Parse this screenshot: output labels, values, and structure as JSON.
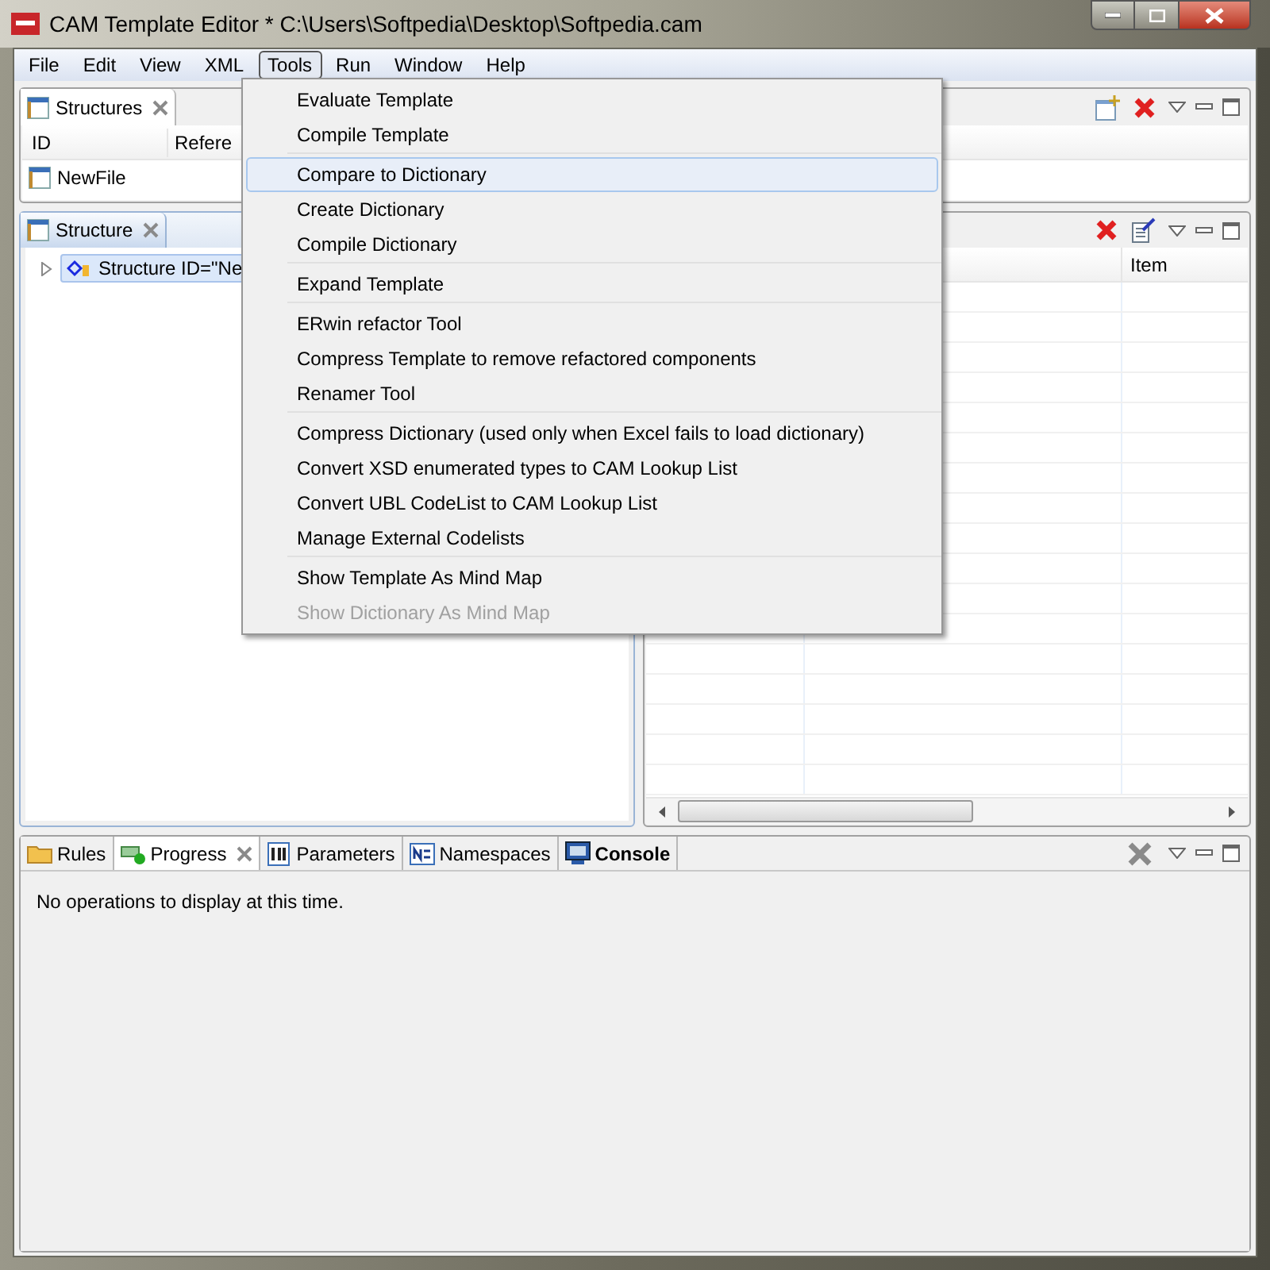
{
  "window": {
    "title": "CAM Template Editor * C:\\Users\\Softpedia\\Desktop\\Softpedia.cam"
  },
  "menu_bar": [
    {
      "label": "File",
      "selected": false
    },
    {
      "label": "Edit",
      "selected": false
    },
    {
      "label": "View",
      "selected": false
    },
    {
      "label": "XML",
      "selected": false
    },
    {
      "label": "Tools",
      "selected": true
    },
    {
      "label": "Run",
      "selected": false
    },
    {
      "label": "Window",
      "selected": false
    },
    {
      "label": "Help",
      "selected": false
    }
  ],
  "tools_menu": {
    "groups": [
      [
        {
          "label": "Evaluate Template",
          "selected": false,
          "disabled": false
        },
        {
          "label": "Compile Template",
          "selected": false,
          "disabled": false
        }
      ],
      [
        {
          "label": "Compare to Dictionary",
          "selected": true,
          "disabled": false
        },
        {
          "label": "Create Dictionary",
          "selected": false,
          "disabled": false
        },
        {
          "label": "Compile Dictionary",
          "selected": false,
          "disabled": false
        }
      ],
      [
        {
          "label": "Expand Template",
          "selected": false,
          "disabled": false
        }
      ],
      [
        {
          "label": "ERwin refactor Tool",
          "selected": false,
          "disabled": false
        },
        {
          "label": "Compress Template to remove refactored components",
          "selected": false,
          "disabled": false
        },
        {
          "label": "Renamer Tool",
          "selected": false,
          "disabled": false
        }
      ],
      [
        {
          "label": "Compress Dictionary (used only when Excel fails to load dictionary)",
          "selected": false,
          "disabled": false
        },
        {
          "label": "Convert XSD enumerated types to CAM Lookup List",
          "selected": false,
          "disabled": false
        },
        {
          "label": "Convert UBL CodeList to CAM Lookup List",
          "selected": false,
          "disabled": false
        },
        {
          "label": "Manage External Codelists",
          "selected": false,
          "disabled": false
        }
      ],
      [
        {
          "label": "Show Template As Mind Map",
          "selected": false,
          "disabled": false
        },
        {
          "label": "Show Dictionary As Mind Map",
          "selected": false,
          "disabled": true
        }
      ]
    ]
  },
  "structures_panel": {
    "tab": "Structures",
    "columns": [
      "ID",
      "Refere"
    ],
    "rows": [
      [
        "NewFile"
      ]
    ]
  },
  "structure_panel": {
    "tab": "Structure",
    "tree": [
      {
        "label": "Structure ID=\"Ne",
        "expanded": false,
        "selected": true
      }
    ]
  },
  "items_table": {
    "columns": [
      "Item"
    ]
  },
  "bottom_panel": {
    "tabs": [
      {
        "label": "Rules",
        "selected": false,
        "bold": false
      },
      {
        "label": "Progress",
        "selected": true,
        "bold": false
      },
      {
        "label": "Parameters",
        "selected": false,
        "bold": false
      },
      {
        "label": "Namespaces",
        "selected": false,
        "bold": false
      },
      {
        "label": "Console",
        "selected": false,
        "bold": true
      }
    ],
    "message": "No operations to display at this time."
  }
}
